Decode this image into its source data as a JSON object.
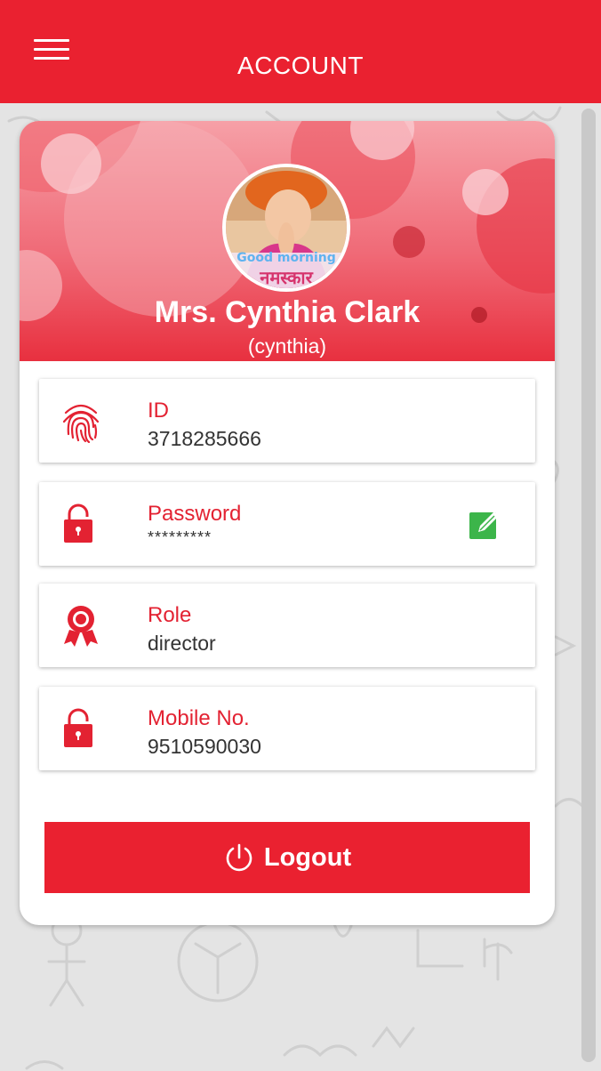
{
  "appbar": {
    "title": "ACCOUNT",
    "menu_icon": "hamburger-menu-icon",
    "color": "#ea2130"
  },
  "profile": {
    "name": "Mrs. Cynthia Clark",
    "username": "(cynthia)",
    "avatar_caption_top": "Good morning",
    "avatar_caption_bottom": "नमस्कार"
  },
  "fields": [
    {
      "label": "ID",
      "value": "3718285666",
      "icon": "fingerprint-icon"
    },
    {
      "label": "Password",
      "value": "*********",
      "icon": "unlock-icon",
      "edit_icon": "edit-pencil-icon"
    },
    {
      "label": "Role",
      "value": "director",
      "icon": "award-ribbon-icon"
    },
    {
      "label": "Mobile No.",
      "value": "9510590030",
      "icon": "unlock-icon"
    }
  ],
  "logout": {
    "label": "Logout",
    "icon": "power-icon"
  },
  "colors": {
    "accent": "#ea2130",
    "label": "#e32232",
    "edit": "#3cb54a",
    "background": "#e4e4e4"
  }
}
